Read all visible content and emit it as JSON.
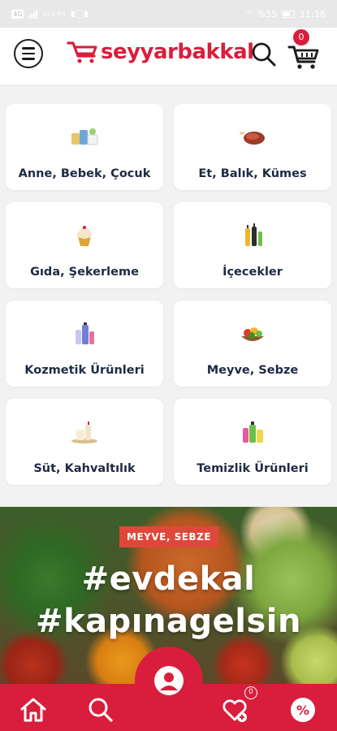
{
  "status_bar": {
    "speed": "33.3 K/s",
    "battery": "%55",
    "time": "11:16"
  },
  "header": {
    "brand": "seyyarbakkal",
    "cart_count": "0",
    "icons": {
      "menu": "hamburger-menu-icon",
      "search": "search-icon",
      "cart": "shopping-cart-icon"
    }
  },
  "categories": [
    {
      "label": "Anne, Bebek, Çocuk",
      "icon": "baby-products-icon"
    },
    {
      "label": "Et, Balık, Kümes",
      "icon": "meat-icon"
    },
    {
      "label": "Gıda, Şekerleme",
      "icon": "cupcake-icon"
    },
    {
      "label": "İçecekler",
      "icon": "drinks-icon"
    },
    {
      "label": "Kozmetik Ürünleri",
      "icon": "cosmetics-icon"
    },
    {
      "label": "Meyve, Sebze",
      "icon": "fruit-vegetable-icon"
    },
    {
      "label": "Süt, Kahvaltılık",
      "icon": "dairy-breakfast-icon"
    },
    {
      "label": "Temizlik Ürünleri",
      "icon": "cleaning-products-icon"
    }
  ],
  "banner": {
    "tag": "MEYVE, SEBZE",
    "line1": "#evdekal",
    "line2": "#kapınagelsin"
  },
  "bottom_nav": {
    "favorites_count": "0",
    "icons": [
      "home-icon",
      "search-icon",
      "profile-icon",
      "favorites-icon",
      "discount-icon"
    ]
  },
  "colors": {
    "brand": "#d81e3c",
    "text": "#1f2a44",
    "tag": "#e0473a"
  }
}
